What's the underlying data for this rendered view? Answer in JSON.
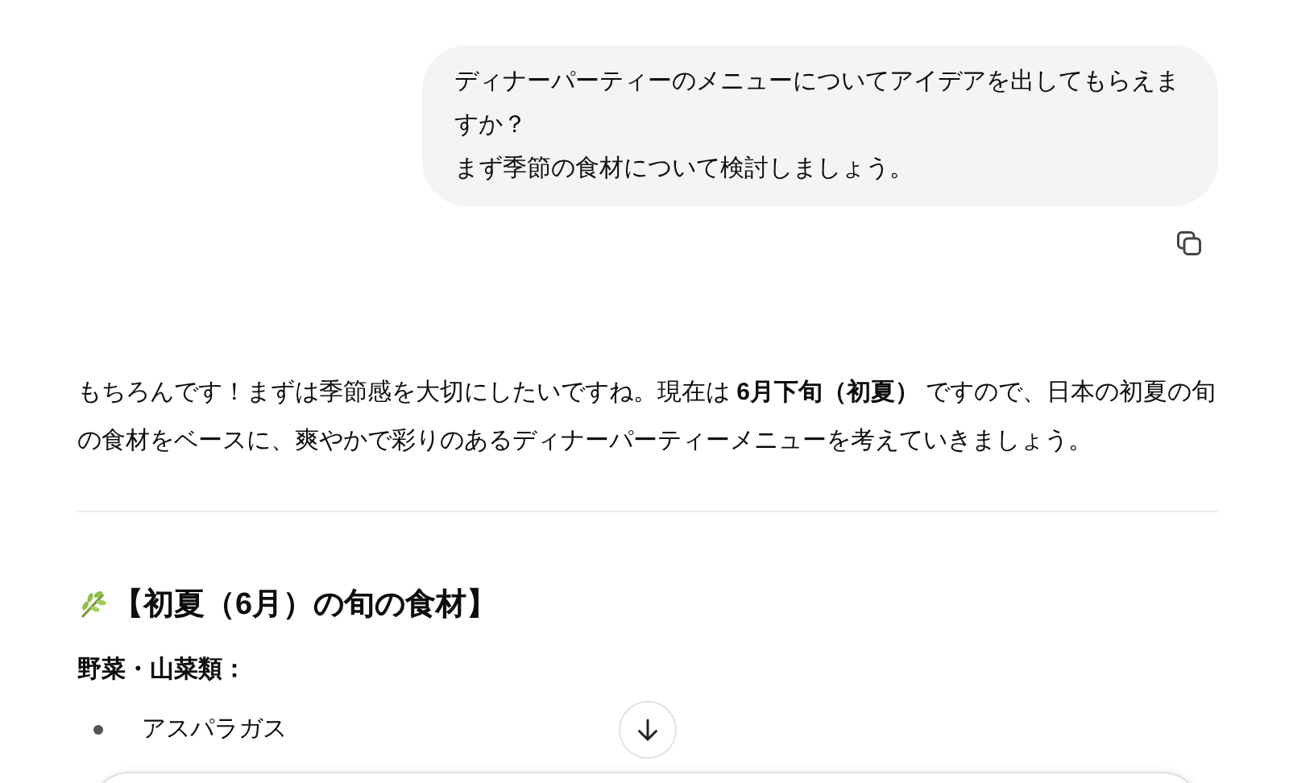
{
  "user_message": {
    "lines": [
      "ディナーパーティーのメニューについてアイデアを出してもらえますか？",
      "まず季節の食材について検討しましょう。"
    ]
  },
  "reply": {
    "paragraph": "もちろんです！まずは季節感を大切にしたいですね。現在は **6月下旬（初夏）** ですので、日本の初夏の旬の食材をベースに、爽やかで彩りのあるディナーパーティーメニューを考えていきましょう。",
    "heading": "【初夏（6月）の旬の食材】",
    "subheading": "野菜・山菜類：",
    "items": [
      "アスパラガス"
    ]
  }
}
